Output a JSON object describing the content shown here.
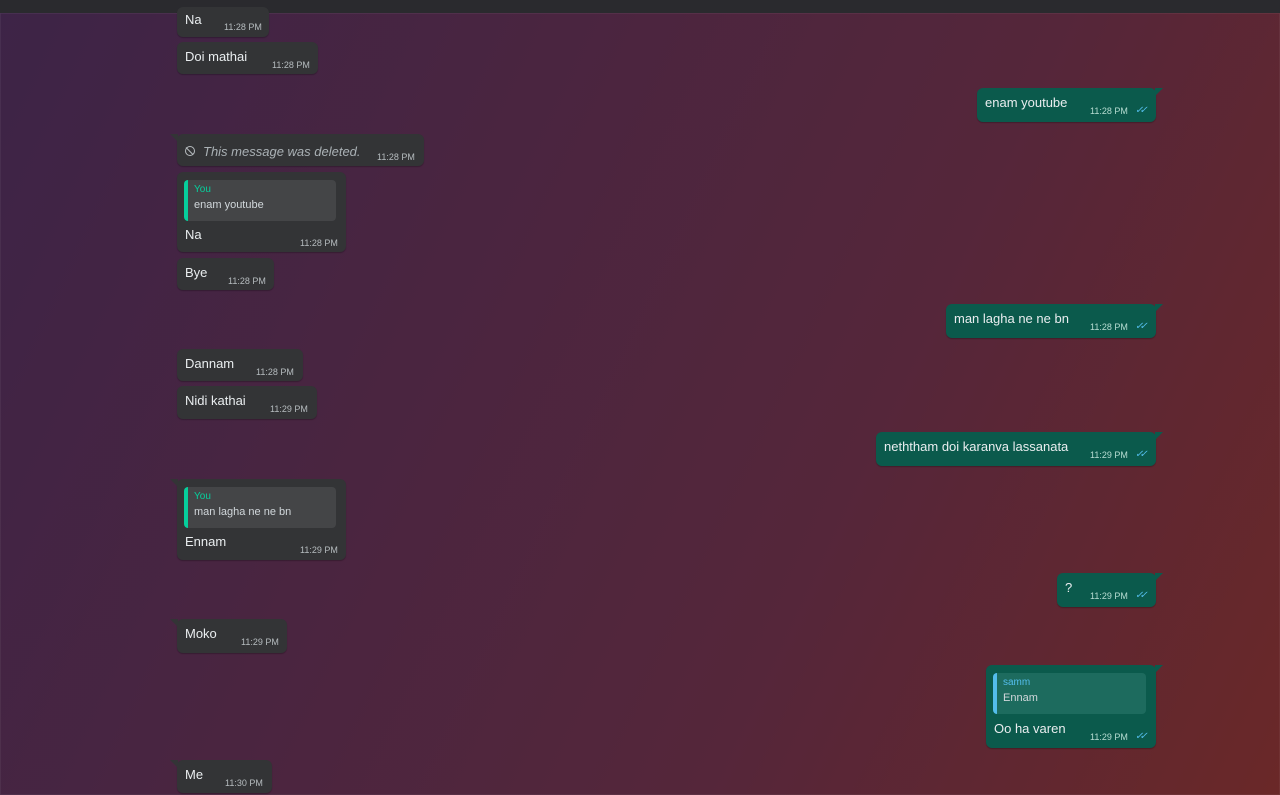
{
  "messages": [
    {
      "dir": "in",
      "text": "Na",
      "time": "11:28 PM"
    },
    {
      "dir": "in",
      "text": "Doi mathai",
      "time": "11:28 PM"
    },
    {
      "dir": "out",
      "text": "enam youtube",
      "time": "11:28 PM",
      "status": "read"
    },
    {
      "dir": "in",
      "deleted": true,
      "text": "This message was deleted.",
      "time": "11:28 PM"
    },
    {
      "dir": "in",
      "quote": {
        "author": "You",
        "text": "enam youtube"
      },
      "text": "Na",
      "time": "11:28 PM"
    },
    {
      "dir": "in",
      "text": "Bye",
      "time": "11:28 PM"
    },
    {
      "dir": "out",
      "text": "man lagha ne ne bn",
      "time": "11:28 PM",
      "status": "read"
    },
    {
      "dir": "in",
      "text": "Dannam",
      "time": "11:28 PM"
    },
    {
      "dir": "in",
      "text": "Nidi kathai",
      "time": "11:29 PM"
    },
    {
      "dir": "out",
      "text": "neththam doi karanva lassanata",
      "time": "11:29 PM",
      "status": "read"
    },
    {
      "dir": "in",
      "quote": {
        "author": "You",
        "text": "man lagha ne ne bn"
      },
      "text": "Ennam",
      "time": "11:29 PM"
    },
    {
      "dir": "out",
      "text": "?",
      "time": "11:29 PM",
      "status": "read"
    },
    {
      "dir": "in",
      "text": "Moko",
      "time": "11:29 PM"
    },
    {
      "dir": "out",
      "quote": {
        "author": "samm",
        "text": "Ennam"
      },
      "text": "Oo ha varen",
      "time": "11:29 PM",
      "status": "read"
    },
    {
      "dir": "in",
      "text": "Me",
      "time": "11:30 PM"
    }
  ],
  "icons": {
    "deleted": "blocked-circle-icon",
    "read": "double-check-icon"
  },
  "ticks_glyph": "✓✓",
  "colors": {
    "incoming_bubble": "#333436",
    "outgoing_bubble": "#0b5a4c",
    "read_ticks": "#53bdeb",
    "quote_accent": "#06cf9c"
  }
}
